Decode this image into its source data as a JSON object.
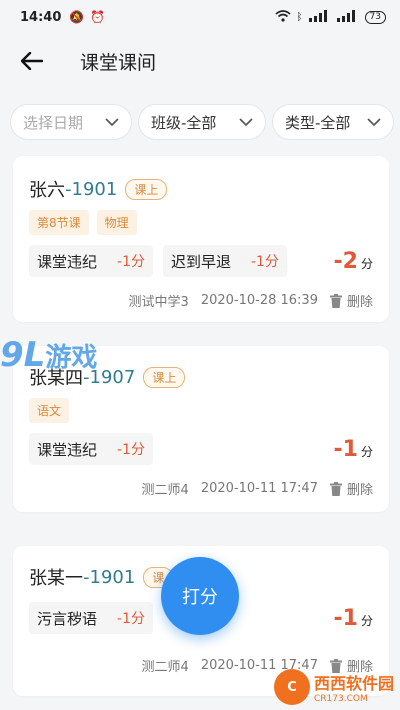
{
  "status_bar": {
    "time": "14:40",
    "battery": "73"
  },
  "header": {
    "title": "课堂课间"
  },
  "filters": [
    {
      "label": "选择日期"
    },
    {
      "label": "班级-全部"
    },
    {
      "label": "类型-全部"
    }
  ],
  "records": [
    {
      "name": "张六",
      "sep": "-",
      "class_no": "1901",
      "status": "课上",
      "tags": [
        "第8节课",
        "物理"
      ],
      "items": [
        {
          "reason": "课堂违纪",
          "points": "-1分"
        },
        {
          "reason": "迟到早退",
          "points": "-1分"
        }
      ],
      "total": "-2",
      "total_unit": "分",
      "recorder": "测试中学3",
      "datetime": "2020-10-28 16:39",
      "delete_label": "删除"
    },
    {
      "name": "张某四",
      "sep": "-",
      "class_no": "1907",
      "status": "课上",
      "tags": [
        "语文"
      ],
      "items": [
        {
          "reason": "课堂违纪",
          "points": "-1分"
        }
      ],
      "total": "-1",
      "total_unit": "分",
      "recorder": "测二师4",
      "datetime": "2020-10-11 17:47",
      "delete_label": "删除"
    },
    {
      "name": "张某一",
      "sep": "-",
      "class_no": "1901",
      "status": "课",
      "tags": [],
      "items": [
        {
          "reason": "污言秽语",
          "points": "-1分"
        }
      ],
      "total": "-1",
      "total_unit": "分",
      "recorder": "测二师4",
      "datetime": "2020-10-11 17:47",
      "delete_label": "删除"
    }
  ],
  "fab": {
    "label": "打分"
  },
  "watermarks": {
    "top_num": "9L",
    "top_text": "游戏",
    "bottom_logo": "C",
    "bottom_text": "西西软件园",
    "bottom_url": "CR173.COM"
  },
  "colors": {
    "accent": "#2f8ef0",
    "class_text": "#2f7d8e",
    "points": "#e05a3a",
    "tag_text": "#d98b3a"
  }
}
